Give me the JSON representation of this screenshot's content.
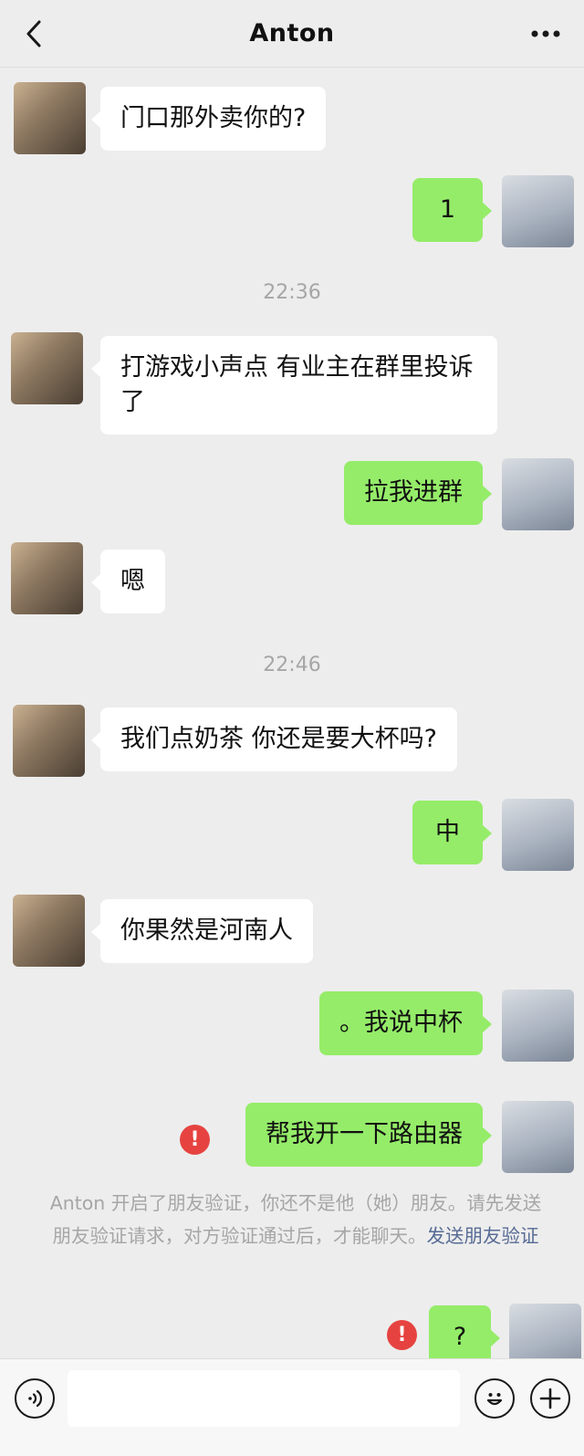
{
  "header": {
    "title": "Anton",
    "back_icon": "chevron-left-icon",
    "more_icon": "more-dots-icon"
  },
  "messages": [
    {
      "side": "in",
      "text": "门口那外卖你的?"
    },
    {
      "side": "out",
      "text": "1"
    },
    {
      "type": "time",
      "text": "22:36"
    },
    {
      "side": "in",
      "text": "打游戏小声点 有业主在群里投诉了"
    },
    {
      "side": "out",
      "text": "拉我进群"
    },
    {
      "side": "in",
      "text": "嗯"
    },
    {
      "type": "time",
      "text": "22:46"
    },
    {
      "side": "in",
      "text": "我们点奶茶 你还是要大杯吗?"
    },
    {
      "side": "out",
      "text": "中"
    },
    {
      "side": "in",
      "text": "你果然是河南人"
    },
    {
      "side": "out",
      "text": "。我说中杯"
    },
    {
      "side": "out",
      "text": "帮我开一下路由器",
      "failed": true
    },
    {
      "side": "out",
      "text": "?",
      "failed": true
    }
  ],
  "system_notice": {
    "text": "Anton 开启了朋友验证，你还不是他（她）朋友。请先发送朋友验证请求，对方验证通过后，才能聊天。",
    "link": "发送朋友验证"
  },
  "error_mark": "!",
  "input_bar": {
    "voice_icon": "voice-icon",
    "emoji_icon": "emoji-icon",
    "plus_icon": "plus-icon",
    "placeholder": ""
  },
  "colors": {
    "background": "#ededed",
    "outgoing_bubble": "#95ec69",
    "incoming_bubble": "#ffffff",
    "error": "#e64340",
    "link": "#576b95"
  }
}
